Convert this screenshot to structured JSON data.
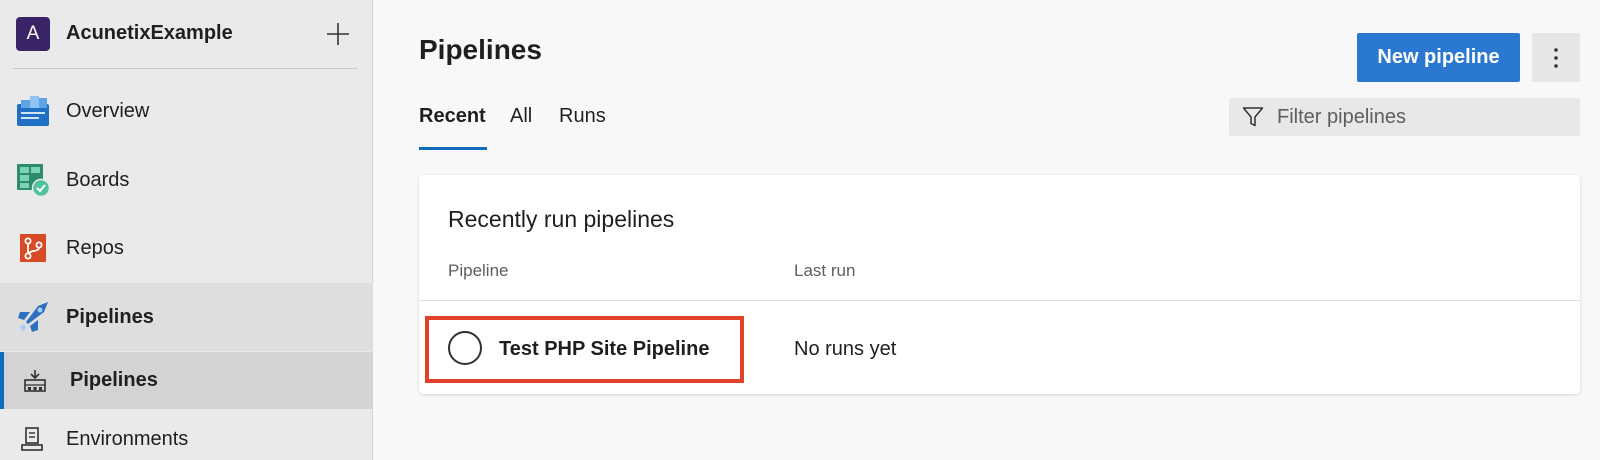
{
  "project": {
    "avatar_letter": "A",
    "name": "AcunetixExample",
    "avatar_color": "#3b2466"
  },
  "nav": {
    "overview": "Overview",
    "boards": "Boards",
    "repos": "Repos",
    "pipelines": "Pipelines",
    "sub_pipelines": "Pipelines",
    "environments": "Environments"
  },
  "main": {
    "title": "Pipelines",
    "new_pipeline_label": "New pipeline",
    "tabs": [
      "Recent",
      "All",
      "Runs"
    ],
    "filter_placeholder": "Filter pipelines",
    "card": {
      "title": "Recently run pipelines",
      "columns": [
        "Pipeline",
        "Last run"
      ],
      "rows": [
        {
          "name": "Test PHP Site Pipeline",
          "last_run": "No runs yet"
        }
      ]
    }
  },
  "colors": {
    "accent": "#0f6cbd",
    "primary_button": "#2b78d0",
    "highlight_box": "#e2412a"
  },
  "icons": {
    "add": "plus-icon",
    "overview": "overview-icon",
    "boards": "boards-icon",
    "repos": "repos-icon",
    "pipelines": "pipelines-icon",
    "sub_pipelines": "pipelines-list-icon",
    "environments": "environments-icon",
    "more": "more-vertical-icon",
    "filter": "filter-icon",
    "status": "status-circle-icon"
  }
}
